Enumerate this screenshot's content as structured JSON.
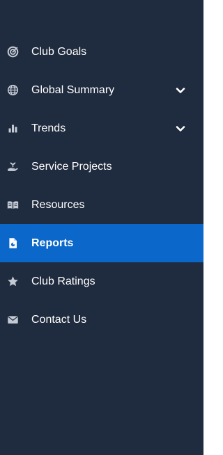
{
  "colors": {
    "sidebar_background": "#1f2b3e",
    "active_background": "#0b67c9",
    "icon": "#c4cad3",
    "text": "#ffffff"
  },
  "menu": {
    "items": [
      {
        "label": "Club Goals",
        "icon": "target-icon",
        "has_submenu": false,
        "active": false
      },
      {
        "label": "Global Summary",
        "icon": "globe-icon",
        "has_submenu": true,
        "active": false
      },
      {
        "label": "Trends",
        "icon": "bar-chart-icon",
        "has_submenu": true,
        "active": false
      },
      {
        "label": "Service Projects",
        "icon": "hand-plant-icon",
        "has_submenu": false,
        "active": false
      },
      {
        "label": "Resources",
        "icon": "book-icon",
        "has_submenu": false,
        "active": false
      },
      {
        "label": "Reports",
        "icon": "report-file-icon",
        "has_submenu": false,
        "active": true
      },
      {
        "label": "Club Ratings",
        "icon": "star-icon",
        "has_submenu": false,
        "active": false
      },
      {
        "label": "Contact Us",
        "icon": "envelope-icon",
        "has_submenu": false,
        "active": false
      }
    ]
  }
}
